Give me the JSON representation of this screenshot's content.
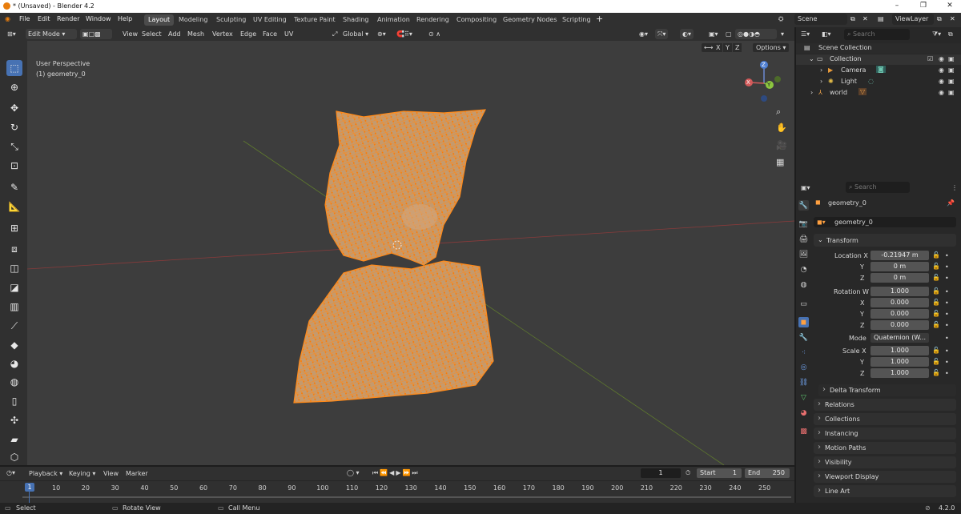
{
  "window": {
    "title": "* (Unsaved) - Blender 4.2"
  },
  "menus": [
    "File",
    "Edit",
    "Render",
    "Window",
    "Help"
  ],
  "workspaces": [
    "Layout",
    "Modeling",
    "Sculpting",
    "UV Editing",
    "Texture Paint",
    "Shading",
    "Animation",
    "Rendering",
    "Compositing",
    "Geometry Nodes",
    "Scripting"
  ],
  "scene": {
    "scene_name": "Scene",
    "view_layer": "ViewLayer"
  },
  "viewport_header": {
    "mode": "Edit Mode",
    "menus": [
      "View",
      "Select",
      "Add",
      "Mesh",
      "Vertex",
      "Edge",
      "Face",
      "UV"
    ],
    "orientation": "Global",
    "options": "Options",
    "axes": [
      "X",
      "Y",
      "Z"
    ]
  },
  "viewport": {
    "perspective": "User Perspective",
    "object_label": "(1) geometry_0",
    "gizmo": {
      "x": "X",
      "y": "Y",
      "z": "Z"
    }
  },
  "outliner": {
    "search_placeholder": "Search",
    "root": "Scene Collection",
    "collection": "Collection",
    "items": [
      "Camera",
      "Light",
      "world"
    ]
  },
  "properties": {
    "search_placeholder": "Search",
    "object_name": "geometry_0",
    "data_name": "geometry_0",
    "transform": {
      "title": "Transform",
      "location": {
        "label": "Location X",
        "x": "-0.21947 m",
        "y": "0 m",
        "z": "0 m"
      },
      "rotation": {
        "label": "Rotation W",
        "w": "1.000",
        "x": "0.000",
        "y": "0.000",
        "z": "0.000"
      },
      "mode": {
        "label": "Mode",
        "value": "Quaternion (W..."
      },
      "scale": {
        "label": "Scale X",
        "x": "1.000",
        "y": "1.000",
        "z": "1.000"
      },
      "sub_labels": {
        "x": "X",
        "y": "Y",
        "z": "Z",
        "w": "W"
      },
      "delta": "Delta Transform"
    },
    "sections": [
      "Relations",
      "Collections",
      "Instancing",
      "Motion Paths",
      "Visibility",
      "Viewport Display",
      "Line Art"
    ]
  },
  "timeline": {
    "menus": [
      "Playback",
      "Keying",
      "View",
      "Marker"
    ],
    "current_frame": "1",
    "start_label": "Start",
    "start": "1",
    "end_label": "End",
    "end": "250",
    "ticks": [
      "1",
      "10",
      "20",
      "30",
      "40",
      "50",
      "60",
      "70",
      "80",
      "90",
      "100",
      "110",
      "120",
      "130",
      "140",
      "150",
      "160",
      "170",
      "180",
      "190",
      "200",
      "210",
      "220",
      "230",
      "240",
      "250"
    ]
  },
  "statusbar": {
    "select": "Select",
    "rotate": "Rotate View",
    "call_menu": "Call Menu",
    "version": "4.2.0"
  },
  "colors": {
    "accent": "#4772b3",
    "mesh": "#ff8a1a",
    "active_ws": "#4b4b4b"
  }
}
